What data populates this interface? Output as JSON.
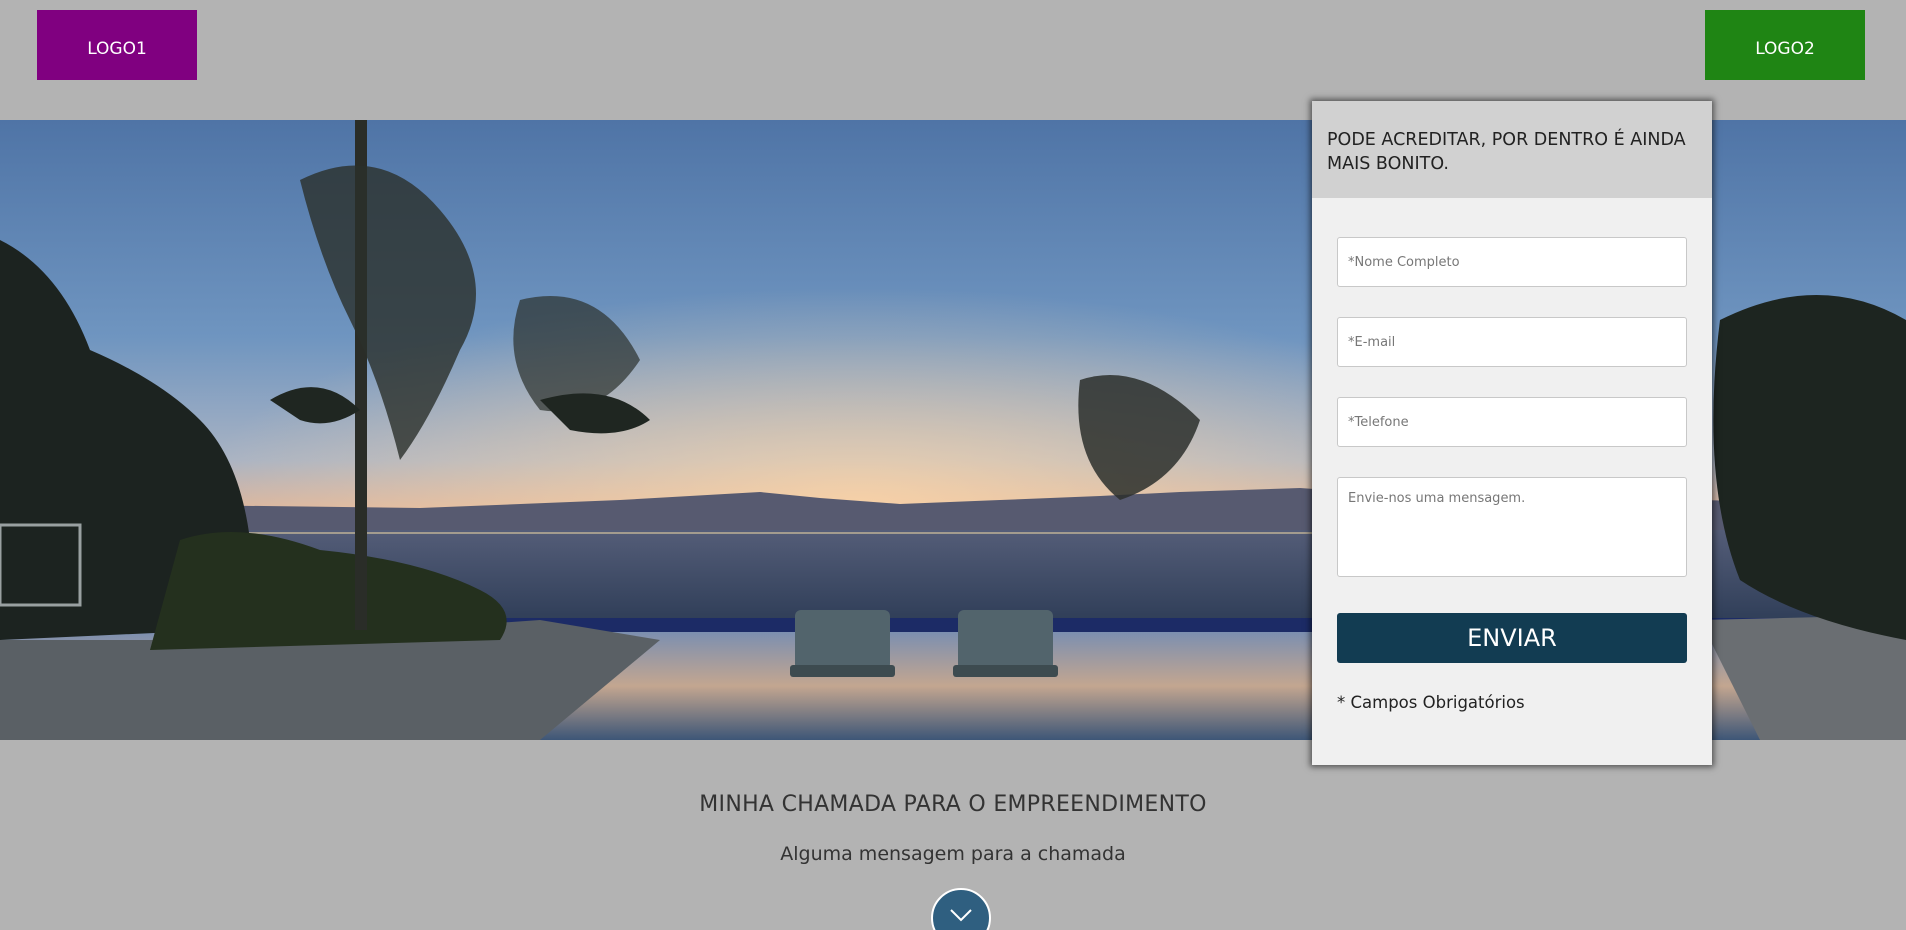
{
  "header": {
    "logo1_label": "LOGO1",
    "logo2_label": "LOGO2"
  },
  "hero": {
    "image": "sunset-over-bay-with-infinity-pool-and-lounge-chairs"
  },
  "form": {
    "heading": "PODE ACREDITAR, POR DENTRO É AINDA MAIS BONITO.",
    "name_placeholder": "*Nome Completo",
    "email_placeholder": "*E-mail",
    "phone_placeholder": "*Telefone",
    "message_placeholder": "Envie-nos uma mensagem.",
    "submit_label": "ENVIAR",
    "required_note": "* Campos Obrigatórios"
  },
  "section": {
    "title": "MINHA CHAMADA PARA O EMPREENDIMENTO",
    "subtitle": "Alguma mensagem para a chamada"
  },
  "scroll_icon": "chevron-down-icon",
  "colors": {
    "logo1_bg": "#800080",
    "logo2_bg": "#1f8514",
    "page_bg": "#b3b3b3",
    "button_bg": "#123c52",
    "scroll_bg": "#2f5f80"
  }
}
